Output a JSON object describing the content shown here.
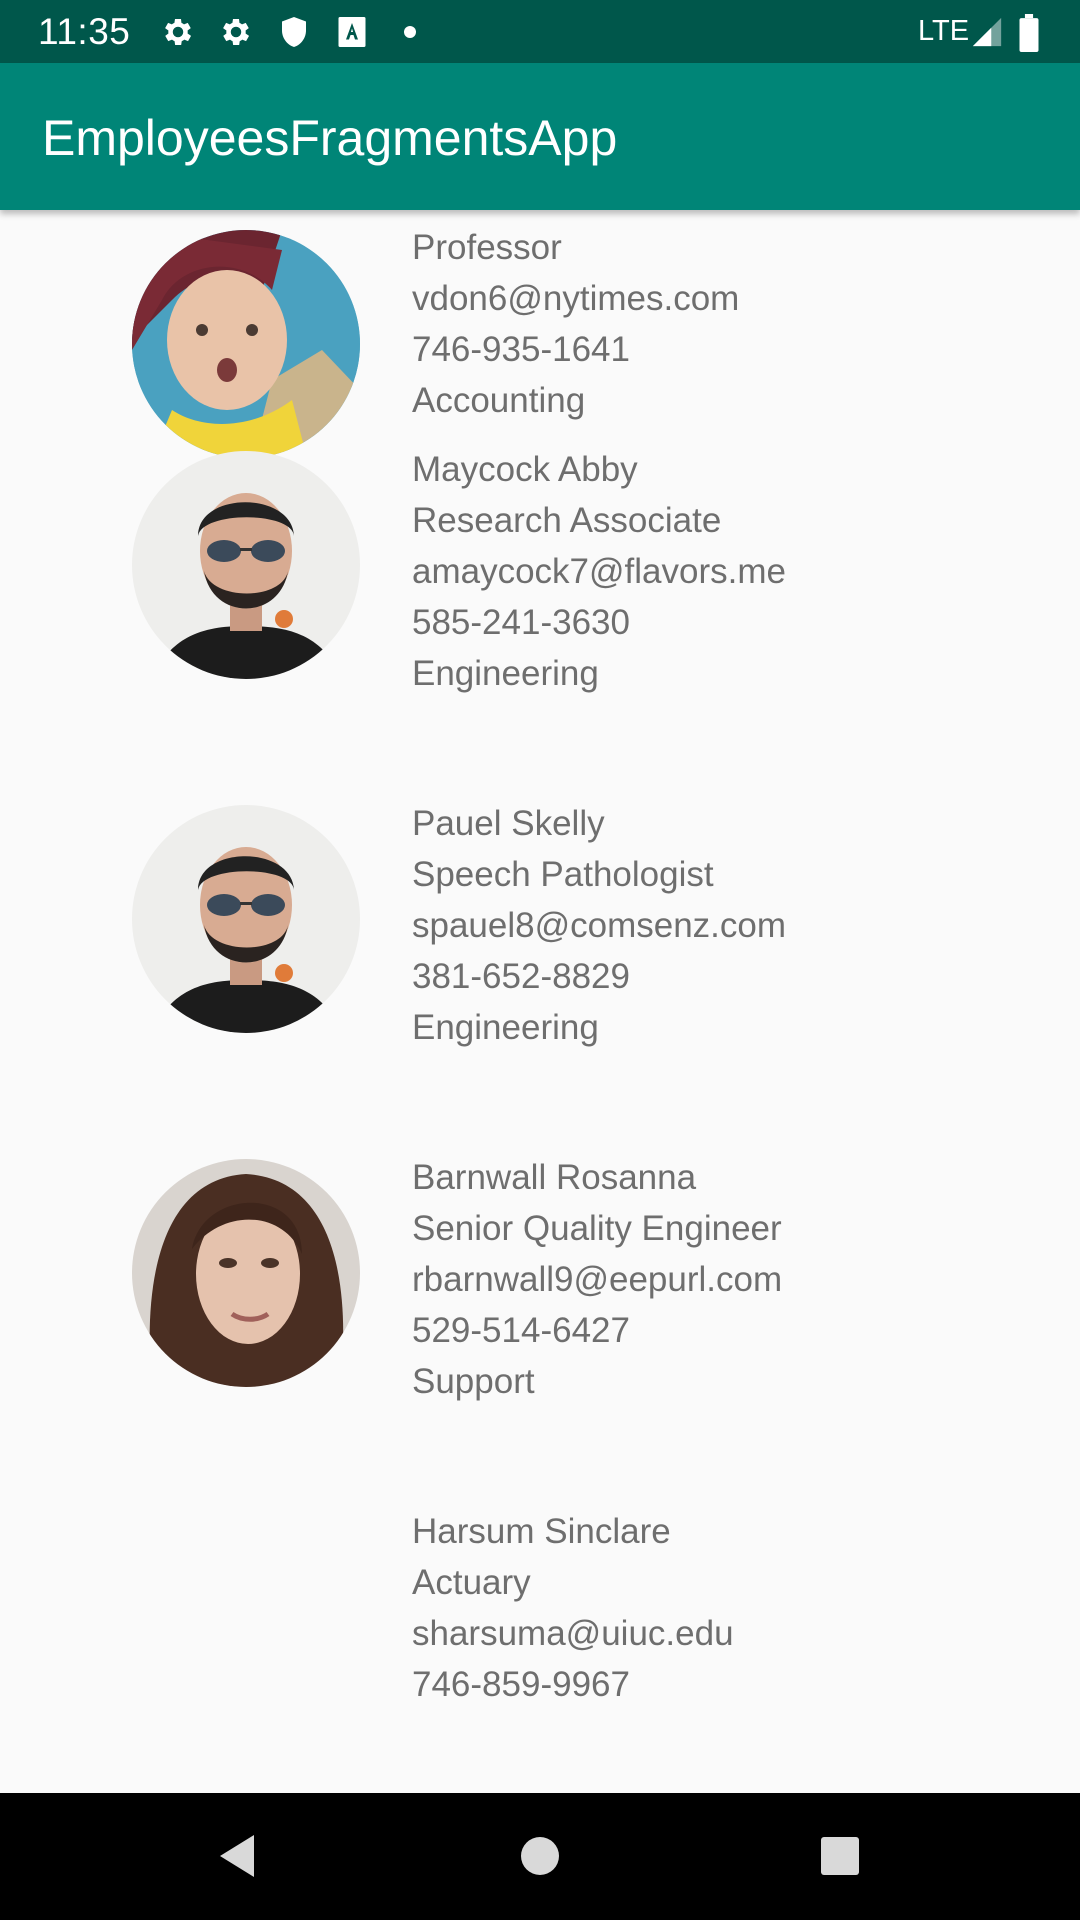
{
  "status_bar": {
    "time": "11:35",
    "network": "LTE",
    "icons": [
      "settings-icon",
      "settings-icon",
      "shield-icon",
      "text-a-icon",
      "dot-icon",
      "signal-icon",
      "battery-icon"
    ]
  },
  "app_bar": {
    "title": "EmployeesFragmentsApp"
  },
  "employees": [
    {
      "name": "",
      "title": "Professor",
      "email": "vdon6@nytimes.com",
      "phone": "746-935-1641",
      "department": "Accounting"
    },
    {
      "name": "Maycock Abby",
      "title": "Research Associate",
      "email": "amaycock7@flavors.me",
      "phone": "585-241-3630",
      "department": "Engineering"
    },
    {
      "name": "Pauel Skelly",
      "title": "Speech Pathologist",
      "email": "spauel8@comsenz.com",
      "phone": "381-652-8829",
      "department": "Engineering"
    },
    {
      "name": "Barnwall Rosanna",
      "title": "Senior Quality Engineer",
      "email": "rbarnwall9@eepurl.com",
      "phone": "529-514-6427",
      "department": "Support"
    },
    {
      "name": "Harsum Sinclare",
      "title": "Actuary",
      "email": "sharsuma@uiuc.edu",
      "phone": "746-859-9967",
      "department": ""
    }
  ],
  "nav_bar": {
    "buttons": [
      "back-icon",
      "home-icon",
      "recents-icon"
    ]
  },
  "colors": {
    "status_bar": "#00574b",
    "app_bar": "#008577",
    "text": "#6e6e6e",
    "background": "#fafafa"
  }
}
